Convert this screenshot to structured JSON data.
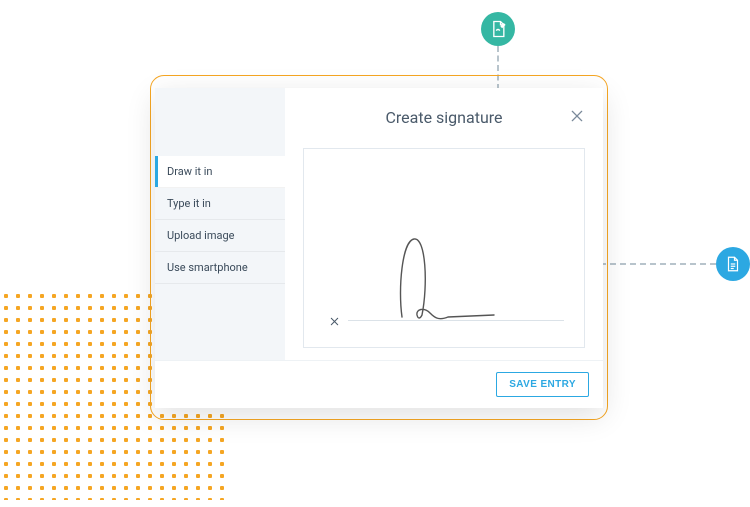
{
  "header": {
    "title": "Create signature"
  },
  "sidebar": {
    "items": [
      {
        "label": "Draw it in",
        "active": true
      },
      {
        "label": "Type it in",
        "active": false
      },
      {
        "label": "Upload image",
        "active": false
      },
      {
        "label": "Use smartphone",
        "active": false
      }
    ]
  },
  "footer": {
    "save_label": "SAVE ENTRY"
  },
  "icons": {
    "close": "close-icon",
    "clear_signature": "clear-signature-icon",
    "badge_top": "sign-document-icon",
    "badge_right": "document-icon"
  }
}
